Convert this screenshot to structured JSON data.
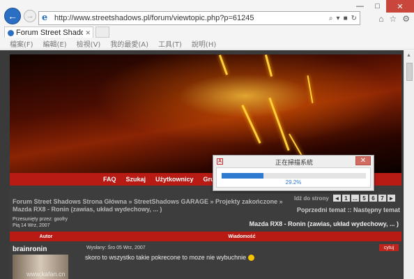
{
  "browser": {
    "url": "http://www.streetshadows.pl/forum/viewtopic.php?p=61245",
    "tab_title": "Forum Street Shado...",
    "window_controls": {
      "minimize": "—",
      "maximize": "□",
      "close": "✕"
    },
    "menu": [
      "檔案(F)",
      "編輯(E)",
      "檢視(V)",
      "我的最愛(A)",
      "工具(T)",
      "說明(H)"
    ]
  },
  "forum": {
    "nav": [
      "FAQ",
      "Szukaj",
      "Użytkownicy",
      "Grup"
    ],
    "breadcrumb": "Forum Street Shadows Strona Główna » StreetShadows GARAGE » Projekty zakończone » Mazda RX8 - Ronin (zawias, układ wydechowy, ... )",
    "pager_label": "Idź do strony",
    "pages": [
      "◄",
      "1",
      "...",
      "5",
      "6",
      "7",
      "►"
    ],
    "prev_next": "Poprzedni temat :: Następny temat",
    "moved_by_label": "Przesunięty przez: goofry",
    "moved_date": "Pią 14 Wrz, 2007",
    "topic_title": "Mazda RX8 - Ronin (zawias, układ wydechowy, ... )",
    "col_author": "Autor",
    "col_message": "Wiadomość",
    "post": {
      "author": "brainronin",
      "meta": "Wysłany: Śro 05 Wrz, 2007",
      "quote_btn": "cytuj",
      "body": "skoro to wszystko takie pokrecone to moze nie wybuchnie"
    },
    "watermark": "www.kafan.cn"
  },
  "dialog": {
    "title": "正在掃描系統",
    "progress_percent": 29.2,
    "progress_label": "29.2%"
  }
}
